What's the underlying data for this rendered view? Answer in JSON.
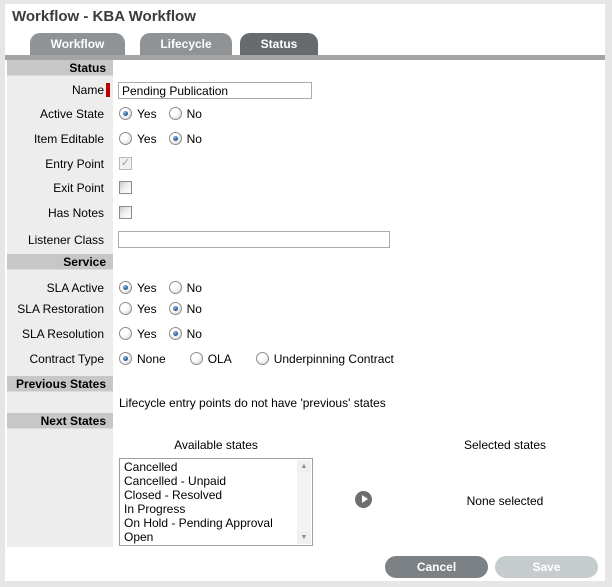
{
  "header": {
    "title": "Workflow - KBA Workflow"
  },
  "tabs": [
    {
      "label": "Workflow",
      "active": false
    },
    {
      "label": "Lifecycle",
      "active": false
    },
    {
      "label": "Status",
      "active": true
    }
  ],
  "sections": {
    "status": "Status",
    "service": "Service",
    "previous_states": "Previous States",
    "next_states": "Next States"
  },
  "fields": {
    "name": {
      "label": "Name",
      "value": "Pending Publication",
      "required": true
    },
    "active_state": {
      "label": "Active State",
      "yes": "Yes",
      "no": "No",
      "selected": "Yes"
    },
    "item_editable": {
      "label": "Item Editable",
      "yes": "Yes",
      "no": "No",
      "selected": "No"
    },
    "entry_point": {
      "label": "Entry Point",
      "checked": true,
      "disabled": true
    },
    "exit_point": {
      "label": "Exit Point",
      "checked": false,
      "disabled": false
    },
    "has_notes": {
      "label": "Has Notes",
      "checked": false,
      "disabled": false
    },
    "listener_class": {
      "label": "Listener Class",
      "value": ""
    },
    "sla_active": {
      "label": "SLA Active",
      "yes": "Yes",
      "no": "No",
      "selected": "Yes"
    },
    "sla_restoration": {
      "label": "SLA Restoration",
      "yes": "Yes",
      "no": "No",
      "selected": "No"
    },
    "sla_resolution": {
      "label": "SLA Resolution",
      "yes": "Yes",
      "no": "No",
      "selected": "No"
    },
    "contract_type": {
      "label": "Contract Type",
      "options": [
        "None",
        "OLA",
        "Underpinning Contract"
      ],
      "selected": "None"
    }
  },
  "previous_states": {
    "message": "Lifecycle entry points do not have 'previous' states"
  },
  "next_states": {
    "available_label": "Available states",
    "selected_label": "Selected states",
    "available_items": [
      "Cancelled",
      "Cancelled - Unpaid",
      "Closed - Resolved",
      "In Progress",
      "On Hold - Pending Approval",
      "Open"
    ],
    "none_selected": "None selected"
  },
  "footer": {
    "cancel": "Cancel",
    "save": "Save"
  },
  "colors": {
    "tab_inactive": "#8f9395",
    "tab_active": "#676b6d",
    "tab_underline": "#a4a4a4",
    "section_header_bg": "#c7c7c7",
    "label_column_bg": "#ededed",
    "required_mark": "#c00000",
    "radio_dot": "#1d4a85",
    "cancel_button_bg": "#7b8184",
    "save_button_bg": "#c6cbcd",
    "move_button_bg": "#6e6e6e"
  }
}
